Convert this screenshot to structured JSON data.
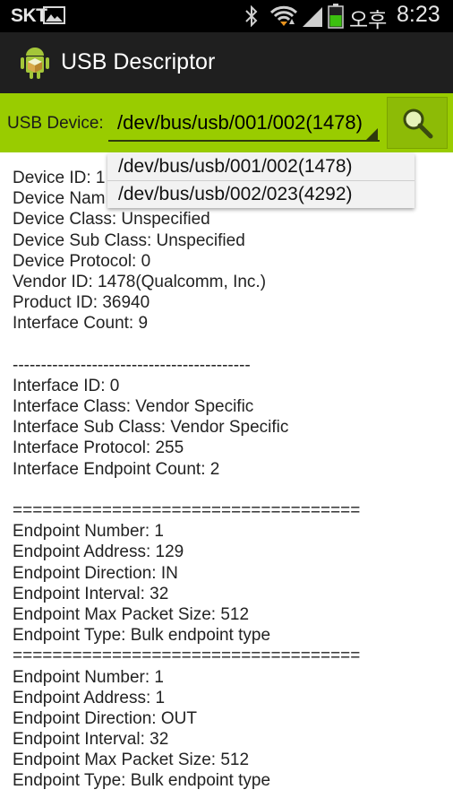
{
  "status_bar": {
    "carrier": "SKT",
    "ampm": "오후",
    "time": "8:23",
    "battery_color": "#3cc00f"
  },
  "app": {
    "title": "USB Descriptor",
    "accent_color": "#99cc00"
  },
  "toolbar": {
    "device_label": "USB Device:",
    "selected_device": "/dev/bus/usb/001/002(1478)",
    "search_icon": "search-icon"
  },
  "dropdown": {
    "options": [
      "/dev/bus/usb/001/002(1478)",
      "/dev/bus/usb/002/023(4292)"
    ]
  },
  "descriptor": {
    "lines": [
      "Device ID: 1",
      "Device Nam",
      "Device Class: Unspecified",
      "Device Sub Class: Unspecified",
      "Device Protocol: 0",
      "Vendor ID: 1478(Qualcomm, Inc.)",
      "Product ID: 36940",
      "Interface Count: 9",
      "",
      "------------------------------------------",
      "Interface ID: 0",
      "Interface Class: Vendor Specific",
      "Interface Sub Class: Vendor Specific",
      "Interface Protocol: 255",
      "Interface Endpoint Count: 2",
      "",
      "===================================",
      "Endpoint Number: 1",
      "Endpoint Address: 129",
      "Endpoint Direction: IN",
      "Endpoint Interval: 32",
      "Endpoint Max Packet Size: 512",
      "Endpoint Type: Bulk endpoint type",
      "===================================",
      "Endpoint Number: 1",
      "Endpoint Address: 1",
      "Endpoint Direction: OUT",
      "Endpoint Interval: 32",
      "Endpoint Max Packet Size: 512",
      "Endpoint Type: Bulk endpoint type"
    ]
  }
}
